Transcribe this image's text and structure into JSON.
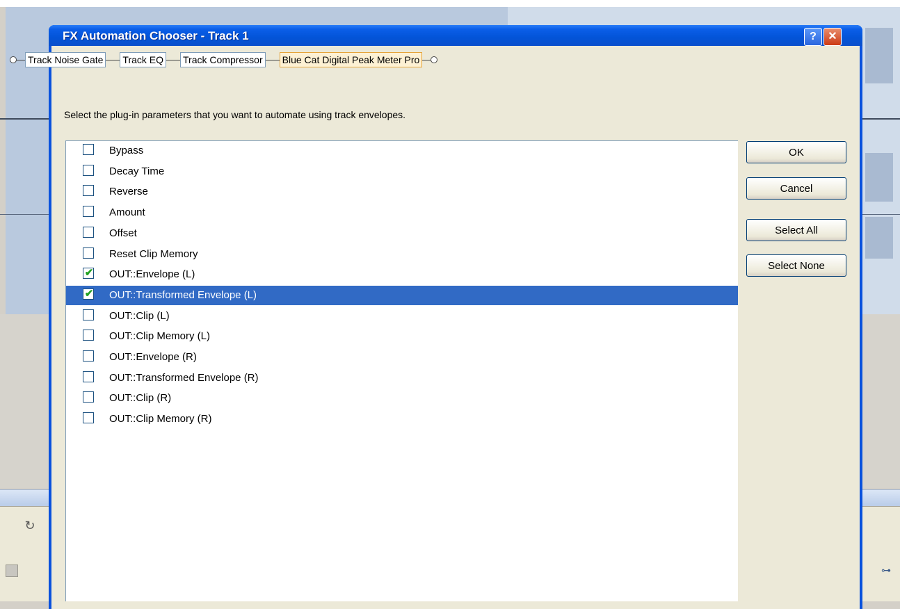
{
  "dialog": {
    "title": "FX Automation Chooser - Track 1",
    "help_glyph": "?",
    "close_glyph": "✕",
    "instruction": "Select the plug-in parameters that you want to automate using track envelopes."
  },
  "plugin_chain": [
    {
      "label": "Track Noise Gate",
      "active": false
    },
    {
      "label": "Track EQ",
      "active": false
    },
    {
      "label": "Track Compressor",
      "active": false
    },
    {
      "label": "Blue Cat Digital Peak Meter Pro",
      "active": true
    }
  ],
  "parameters": [
    {
      "label": "Bypass",
      "checked": false,
      "selected": false
    },
    {
      "label": "Decay Time",
      "checked": false,
      "selected": false
    },
    {
      "label": "Reverse",
      "checked": false,
      "selected": false
    },
    {
      "label": "Amount",
      "checked": false,
      "selected": false
    },
    {
      "label": "Offset",
      "checked": false,
      "selected": false
    },
    {
      "label": "Reset Clip Memory",
      "checked": false,
      "selected": false
    },
    {
      "label": "OUT::Envelope (L)",
      "checked": true,
      "selected": false
    },
    {
      "label": "OUT::Transformed Envelope (L)",
      "checked": true,
      "selected": true
    },
    {
      "label": "OUT::Clip (L)",
      "checked": false,
      "selected": false
    },
    {
      "label": "OUT::Clip Memory (L)",
      "checked": false,
      "selected": false
    },
    {
      "label": "OUT::Envelope (R)",
      "checked": false,
      "selected": false
    },
    {
      "label": "OUT::Transformed Envelope (R)",
      "checked": false,
      "selected": false
    },
    {
      "label": "OUT::Clip (R)",
      "checked": false,
      "selected": false
    },
    {
      "label": "OUT::Clip Memory (R)",
      "checked": false,
      "selected": false
    }
  ],
  "buttons": {
    "ok": "OK",
    "cancel": "Cancel",
    "select_all": "Select All",
    "select_none": "Select None"
  },
  "colors": {
    "title_bar": "#0354d8",
    "selection": "#316ac5",
    "check": "#21a121",
    "active_plugin_border": "#e5a43a"
  }
}
